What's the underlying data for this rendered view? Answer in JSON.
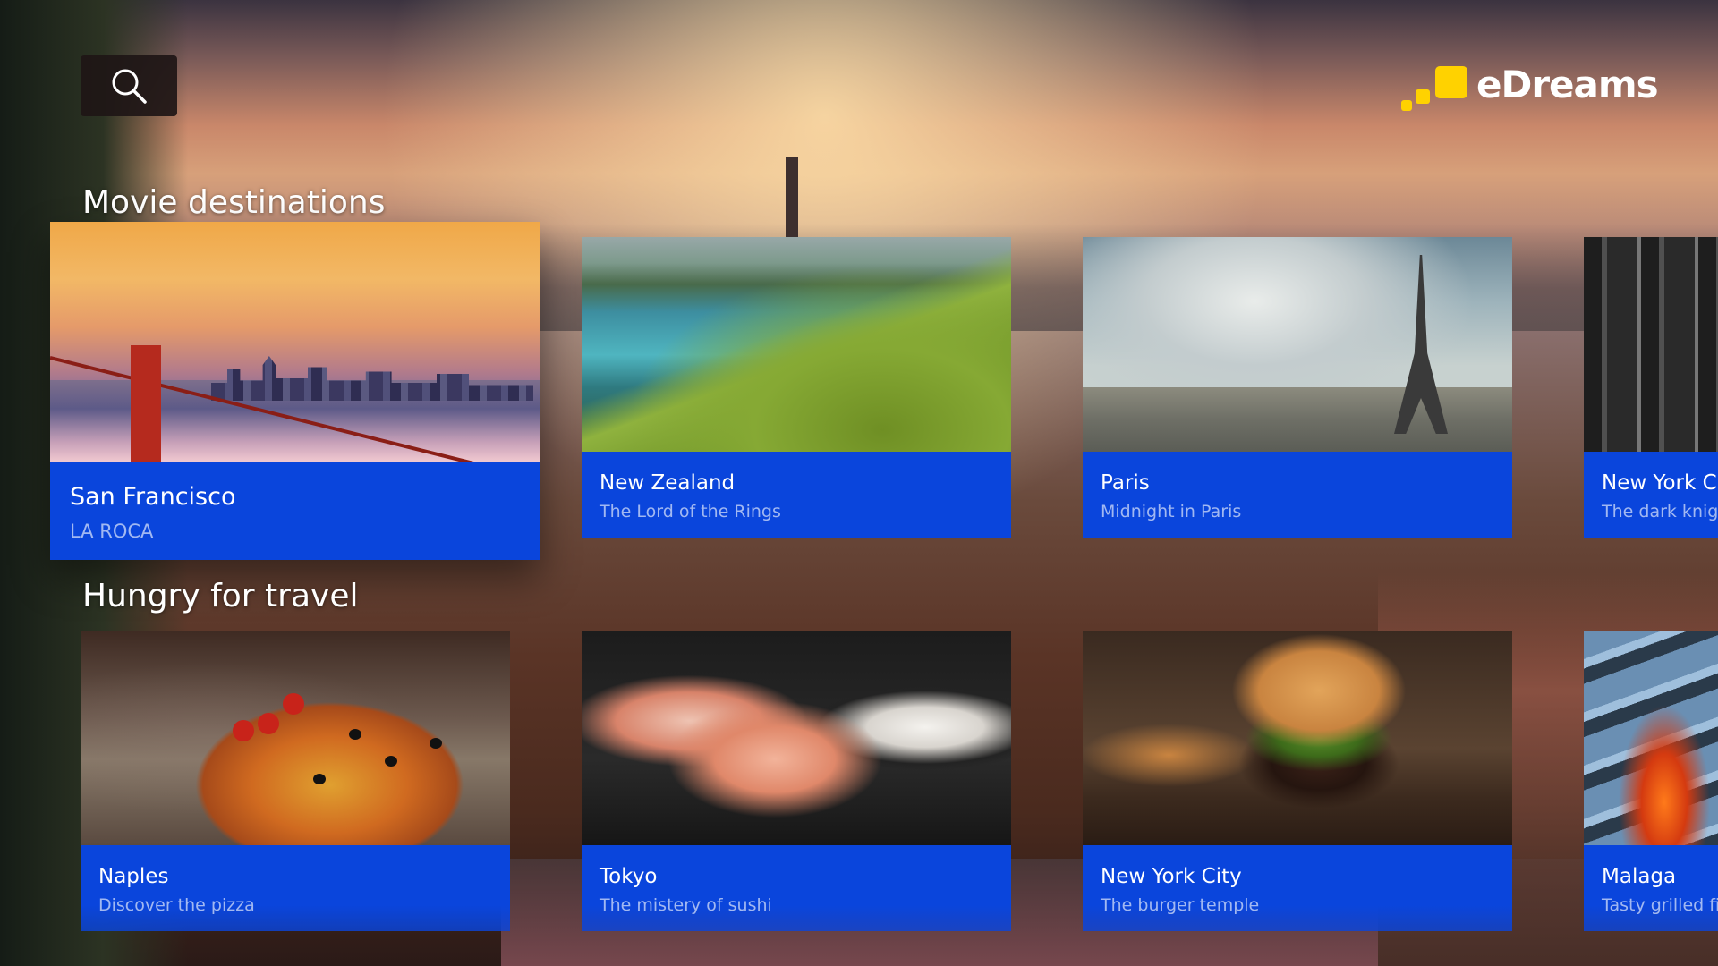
{
  "app": {
    "logo_text": "eDreams",
    "brand_color": "#ffd200",
    "card_color": "#0a45dc"
  },
  "search": {
    "icon": "search-icon"
  },
  "sections": [
    {
      "title": "Movie destinations",
      "cards": [
        {
          "title": "San Francisco",
          "subtitle": "LA ROCA",
          "focused": true
        },
        {
          "title": "New Zealand",
          "subtitle": "The Lord of the Rings"
        },
        {
          "title": "Paris",
          "subtitle": "Midnight in Paris"
        },
        {
          "title": "New York Ci",
          "subtitle": "The dark knigh"
        }
      ]
    },
    {
      "title": "Hungry for travel",
      "cards": [
        {
          "title": "Naples",
          "subtitle": "Discover the pizza"
        },
        {
          "title": "Tokyo",
          "subtitle": "The mistery of sushi"
        },
        {
          "title": "New York City",
          "subtitle": "The burger temple"
        },
        {
          "title": "Malaga",
          "subtitle": "Tasty grilled fis"
        }
      ]
    }
  ]
}
